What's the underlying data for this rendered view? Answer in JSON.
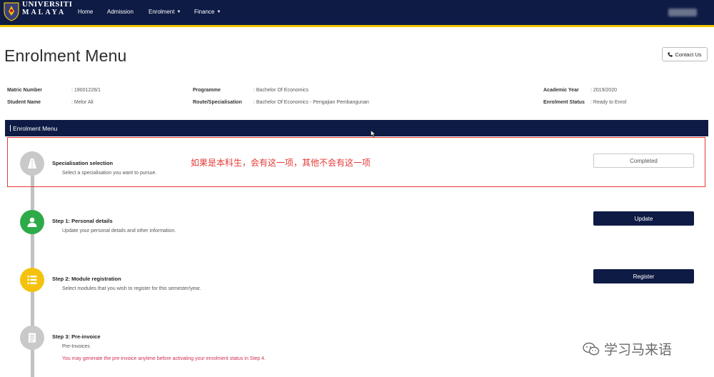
{
  "brand": {
    "line1": "UNIVERSITI",
    "line2": "MALAYA"
  },
  "nav": {
    "items": [
      {
        "label": "Home",
        "dropdown": false
      },
      {
        "label": "Admission",
        "dropdown": false
      },
      {
        "label": "Enrolment",
        "dropdown": true
      },
      {
        "label": "Finance",
        "dropdown": true
      }
    ],
    "caret": "▼"
  },
  "page": {
    "title": "Enrolment Menu",
    "contact_label": "Contact Us"
  },
  "student": {
    "matric_label": "Matric Number",
    "matric_value": ": 19001228/1",
    "name_label": "Student Name",
    "name_value": ": Melor Ali",
    "programme_label": "Programme",
    "programme_value": ": Bachelor Of Economics",
    "route_label": "Route/Specialisation",
    "route_value": ": Bachelor Of Economics - Pengajian Pembangunan",
    "year_label": "Academic Year",
    "year_value": ": 2019/2020",
    "status_label": "Enrolment Status",
    "status_value": ": Ready to Enrol"
  },
  "menu": {
    "header": "Enrolment Menu"
  },
  "steps": [
    {
      "title": "Specialisation selection",
      "desc": "Select a specialisation you want to pursue.",
      "button": "Completed",
      "icon": "road-icon",
      "color": "#c9c9c9"
    },
    {
      "title": "Step 1: Personal details",
      "desc": "Update your personal details and other information.",
      "button": "Update",
      "icon": "user-icon",
      "color": "#2eab49"
    },
    {
      "title": "Step 2: Module registration",
      "desc": "Select modules that you wish to register for this semester/year.",
      "button": "Register",
      "icon": "list-icon",
      "color": "#f4c20d"
    },
    {
      "title": "Step 3: Pre-invoice",
      "desc": "Pre-Invoices",
      "warning": "You may generate the pre-invoice anytime before activating your enrolment status in Step 4.",
      "icon": "document-icon",
      "color": "#c9c9c9"
    }
  ],
  "annotation": "如果是本科生，会有这一项，其他不会有这一项",
  "watermark": "学习马来语",
  "colors": {
    "navy": "#0e1b45",
    "gold": "#f2c200",
    "green": "#2eab49",
    "yellow": "#f4c20d",
    "gray": "#c9c9c9",
    "red": "#e53935"
  }
}
